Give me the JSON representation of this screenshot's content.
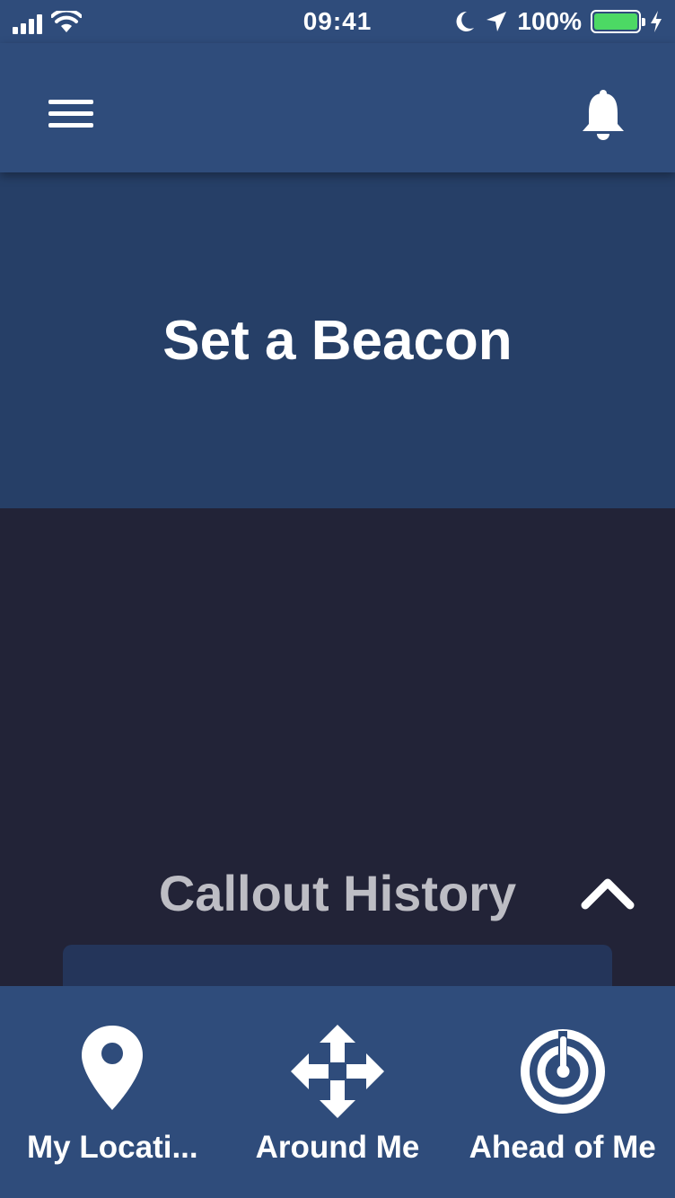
{
  "status_bar": {
    "time": "09:41",
    "battery_percent": "100%",
    "icons": [
      "signal-icon",
      "wifi-icon",
      "moon-icon",
      "location-arrow-icon",
      "battery-icon",
      "charging-bolt-icon"
    ]
  },
  "nav_bar": {
    "icons": [
      "hamburger-menu-icon",
      "bell-icon"
    ]
  },
  "beacon": {
    "title": "Set a Beacon"
  },
  "callout_history": {
    "title": "Callout History",
    "toggle_icon": "chevron-up-icon"
  },
  "tabs": [
    {
      "label": "My Locati...",
      "icon": "map-pin-icon"
    },
    {
      "label": "Around Me",
      "icon": "four-arrows-icon"
    },
    {
      "label": "Ahead of Me",
      "icon": "radar-icon"
    }
  ],
  "colors": {
    "nav_blue": "#2f4c7b",
    "banner_blue": "#263f67",
    "background": "#222337",
    "battery_green": "#4cd964"
  }
}
